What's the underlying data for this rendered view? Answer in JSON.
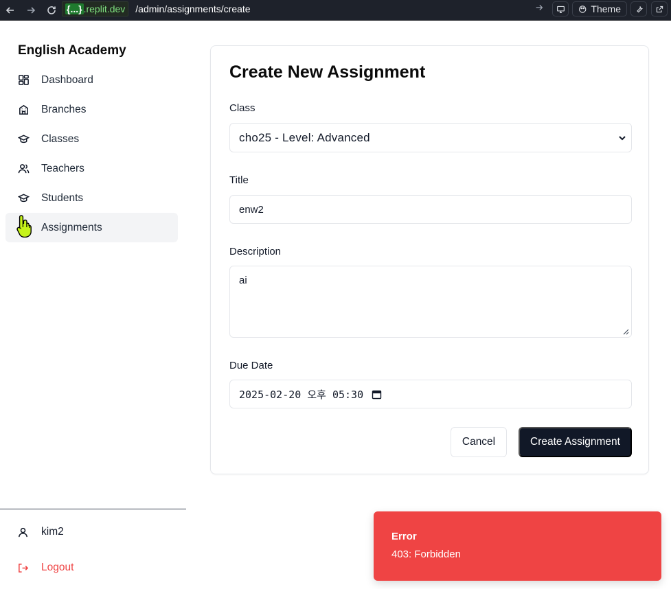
{
  "browser": {
    "domain_badge": "{...}",
    "domain": ".replit.dev",
    "path": "/admin/assignments/create",
    "theme_label": "Theme"
  },
  "sidebar": {
    "brand": "English Academy",
    "items": [
      {
        "label": "Dashboard",
        "icon": "dashboard-icon"
      },
      {
        "label": "Branches",
        "icon": "building-icon"
      },
      {
        "label": "Classes",
        "icon": "graduation-cap-icon"
      },
      {
        "label": "Teachers",
        "icon": "users-icon"
      },
      {
        "label": "Students",
        "icon": "graduation-cap-icon"
      },
      {
        "label": "Assignments",
        "icon": "clipboard-icon"
      }
    ],
    "active_item": "Assignments",
    "user": "kim2",
    "logout": "Logout"
  },
  "form": {
    "title": "Create New Assignment",
    "class_label": "Class",
    "class_value": "cho25 - Level: Advanced",
    "title_label": "Title",
    "title_value": "enw2",
    "description_label": "Description",
    "description_value": "ai",
    "due_date_label": "Due Date",
    "due_date_value": "2025-02-20 오후 05:30",
    "cancel_label": "Cancel",
    "submit_label": "Create Assignment"
  },
  "toast": {
    "title": "Error",
    "message": "403: Forbidden",
    "color": "#ef4444"
  },
  "colors": {
    "primary": "#111827",
    "danger": "#ef4444",
    "active_bg": "#f3f4f6"
  }
}
